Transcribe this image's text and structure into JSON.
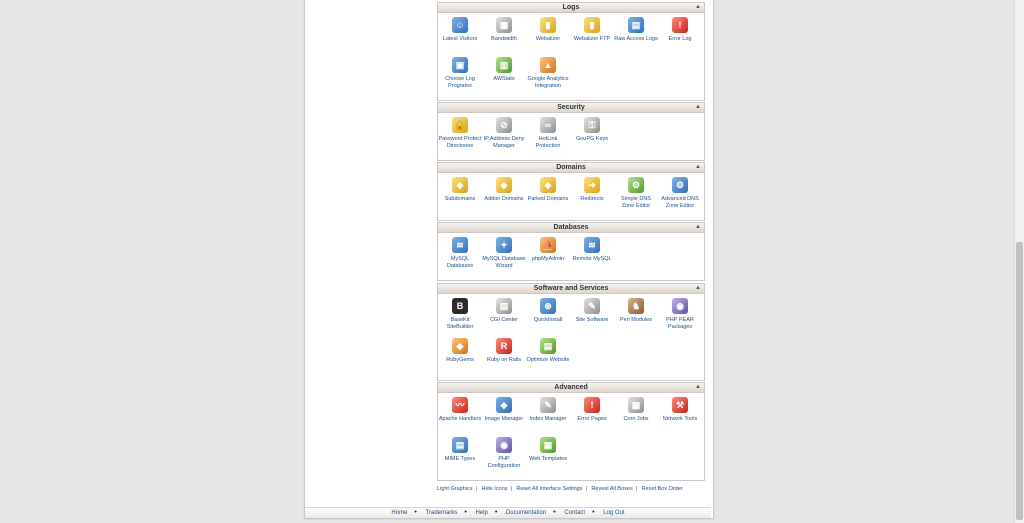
{
  "sections": {
    "logs": {
      "title": "Logs",
      "items": [
        {
          "label": "Latest Visitors",
          "icon": "visitors-icon"
        },
        {
          "label": "Bandwidth",
          "icon": "bandwidth-icon"
        },
        {
          "label": "Webalizer",
          "icon": "webalizer-icon"
        },
        {
          "label": "Webalizer FTP",
          "icon": "webalizer-ftp-icon"
        },
        {
          "label": "Raw Access Logs",
          "icon": "raw-access-logs-icon"
        },
        {
          "label": "Error Log",
          "icon": "error-log-icon"
        },
        {
          "label": "Choose Log Programs",
          "icon": "choose-log-programs-icon"
        },
        {
          "label": "AWStats",
          "icon": "awstats-icon"
        },
        {
          "label": "Google Analytics Integration",
          "icon": "google-analytics-icon"
        }
      ]
    },
    "security": {
      "title": "Security",
      "items": [
        {
          "label": "Password Protect Directories",
          "icon": "folder-lock-icon"
        },
        {
          "label": "IP Address Deny Manager",
          "icon": "ip-deny-icon"
        },
        {
          "label": "HotLink Protection",
          "icon": "hotlink-icon"
        },
        {
          "label": "GnuPG Keys",
          "icon": "key-icon"
        }
      ]
    },
    "domains": {
      "title": "Domains",
      "items": [
        {
          "label": "Subdomains",
          "icon": "subdomains-icon"
        },
        {
          "label": "Addon Domains",
          "icon": "addon-domains-icon"
        },
        {
          "label": "Parked Domains",
          "icon": "parked-domains-icon"
        },
        {
          "label": "Redirects",
          "icon": "redirects-icon"
        },
        {
          "label": "Simple DNS Zone Editor",
          "icon": "dns-zone-icon"
        },
        {
          "label": "Advanced DNS Zone Editor",
          "icon": "advanced-dns-icon"
        }
      ]
    },
    "databases": {
      "title": "Databases",
      "items": [
        {
          "label": "MySQL Databases",
          "icon": "mysql-icon"
        },
        {
          "label": "MySQL Database Wizard",
          "icon": "mysql-wizard-icon"
        },
        {
          "label": "phpMyAdmin",
          "icon": "phpmyadmin-icon"
        },
        {
          "label": "Remote MySQL",
          "icon": "remote-mysql-icon"
        }
      ]
    },
    "software": {
      "title": "Software and Services",
      "items": [
        {
          "label": "BaseKit SiteBuilder",
          "icon": "basekit-icon"
        },
        {
          "label": "CGI Center",
          "icon": "cgi-center-icon"
        },
        {
          "label": "QuickInstall",
          "icon": "quickinstall-icon"
        },
        {
          "label": "Site Software",
          "icon": "site-software-icon"
        },
        {
          "label": "Perl Modules",
          "icon": "perl-camel-icon"
        },
        {
          "label": "PHP PEAR Packages",
          "icon": "php-pear-icon"
        },
        {
          "label": "RubyGems",
          "icon": "rubygems-icon"
        },
        {
          "label": "Ruby on Rails",
          "icon": "ruby-on-rails-icon"
        },
        {
          "label": "Optimize Website",
          "icon": "optimize-website-icon"
        }
      ]
    },
    "advanced": {
      "title": "Advanced",
      "items": [
        {
          "label": "Apache Handlers",
          "icon": "apache-feather-icon"
        },
        {
          "label": "Image Manager",
          "icon": "image-manager-icon"
        },
        {
          "label": "Index Manager",
          "icon": "index-manager-icon"
        },
        {
          "label": "Error Pages",
          "icon": "error-pages-icon"
        },
        {
          "label": "Cron Jobs",
          "icon": "calendar-icon"
        },
        {
          "label": "Network Tools",
          "icon": "toolbox-icon"
        },
        {
          "label": "MIME Types",
          "icon": "mime-types-icon"
        },
        {
          "label": "PHP Configuration",
          "icon": "php-config-icon"
        },
        {
          "label": "Web Templates",
          "icon": "web-templates-icon"
        }
      ]
    }
  },
  "interface_links": [
    "Light Graphics",
    "Hide Icons",
    "Reset All Interface Settings",
    "Reveal All Boxes",
    "Reset Box Order"
  ],
  "footer_links": [
    "Home",
    "Trademarks",
    "Help",
    "Documentation",
    "Contact",
    "Log Out"
  ],
  "collapse_glyph": "▲"
}
